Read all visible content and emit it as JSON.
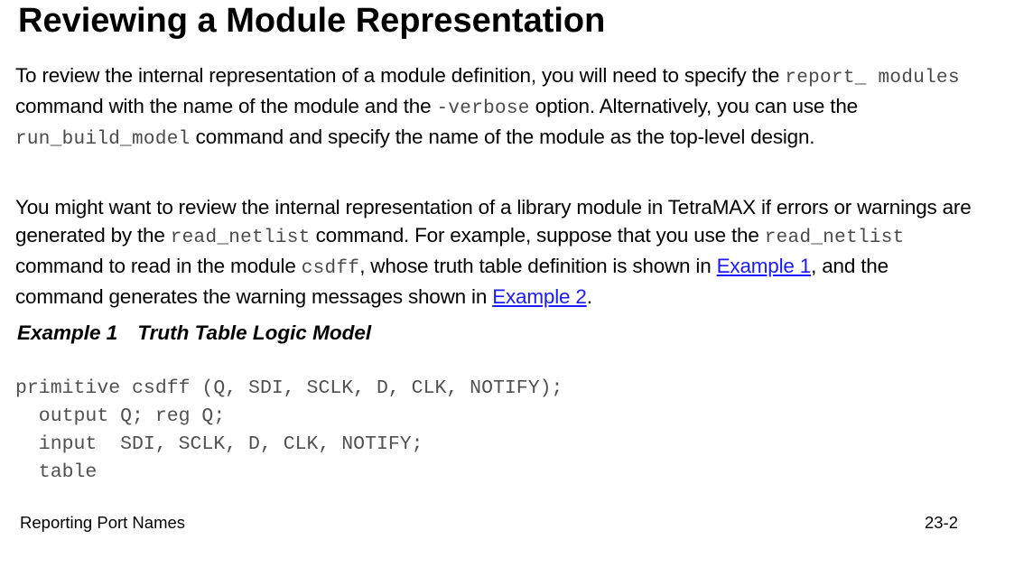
{
  "title": "Reviewing a Module Representation",
  "paragraph1": {
    "t1": "To review the internal representation of a module definition, you will need to specify the ",
    "c1": "report_ modules",
    "t2": " command with the name of the module and the ",
    "c2": "-verbose",
    "t3": " option. Alternatively, you can use the ",
    "c3": "run_build_model",
    "t4": " command and specify the name of the module as the top-level design."
  },
  "paragraph2": {
    "t1": "You might want to review the internal representation of a library module in TetraMAX if errors or warnings are generated by the ",
    "c1": "read_netlist",
    "t2": " command. For example, suppose that you use the ",
    "c2": "read_netlist",
    "t3": " command to read in the module ",
    "c3": "csdff",
    "t4": ", whose truth table definition is shown in ",
    "link1": "Example 1",
    "t5": ", and the command generates the warning messages shown in ",
    "link2": "Example 2",
    "t6": "."
  },
  "example_caption": {
    "number": "Example 1",
    "title": "Truth Table Logic Model"
  },
  "code_lines": [
    "primitive csdff (Q, SDI, SCLK, D, CLK, NOTIFY);",
    "  output Q; reg Q;",
    "  input  SDI, SCLK, D, CLK, NOTIFY;",
    "  table"
  ],
  "footer": {
    "section": "Reporting Port Names",
    "page": "23-2"
  }
}
